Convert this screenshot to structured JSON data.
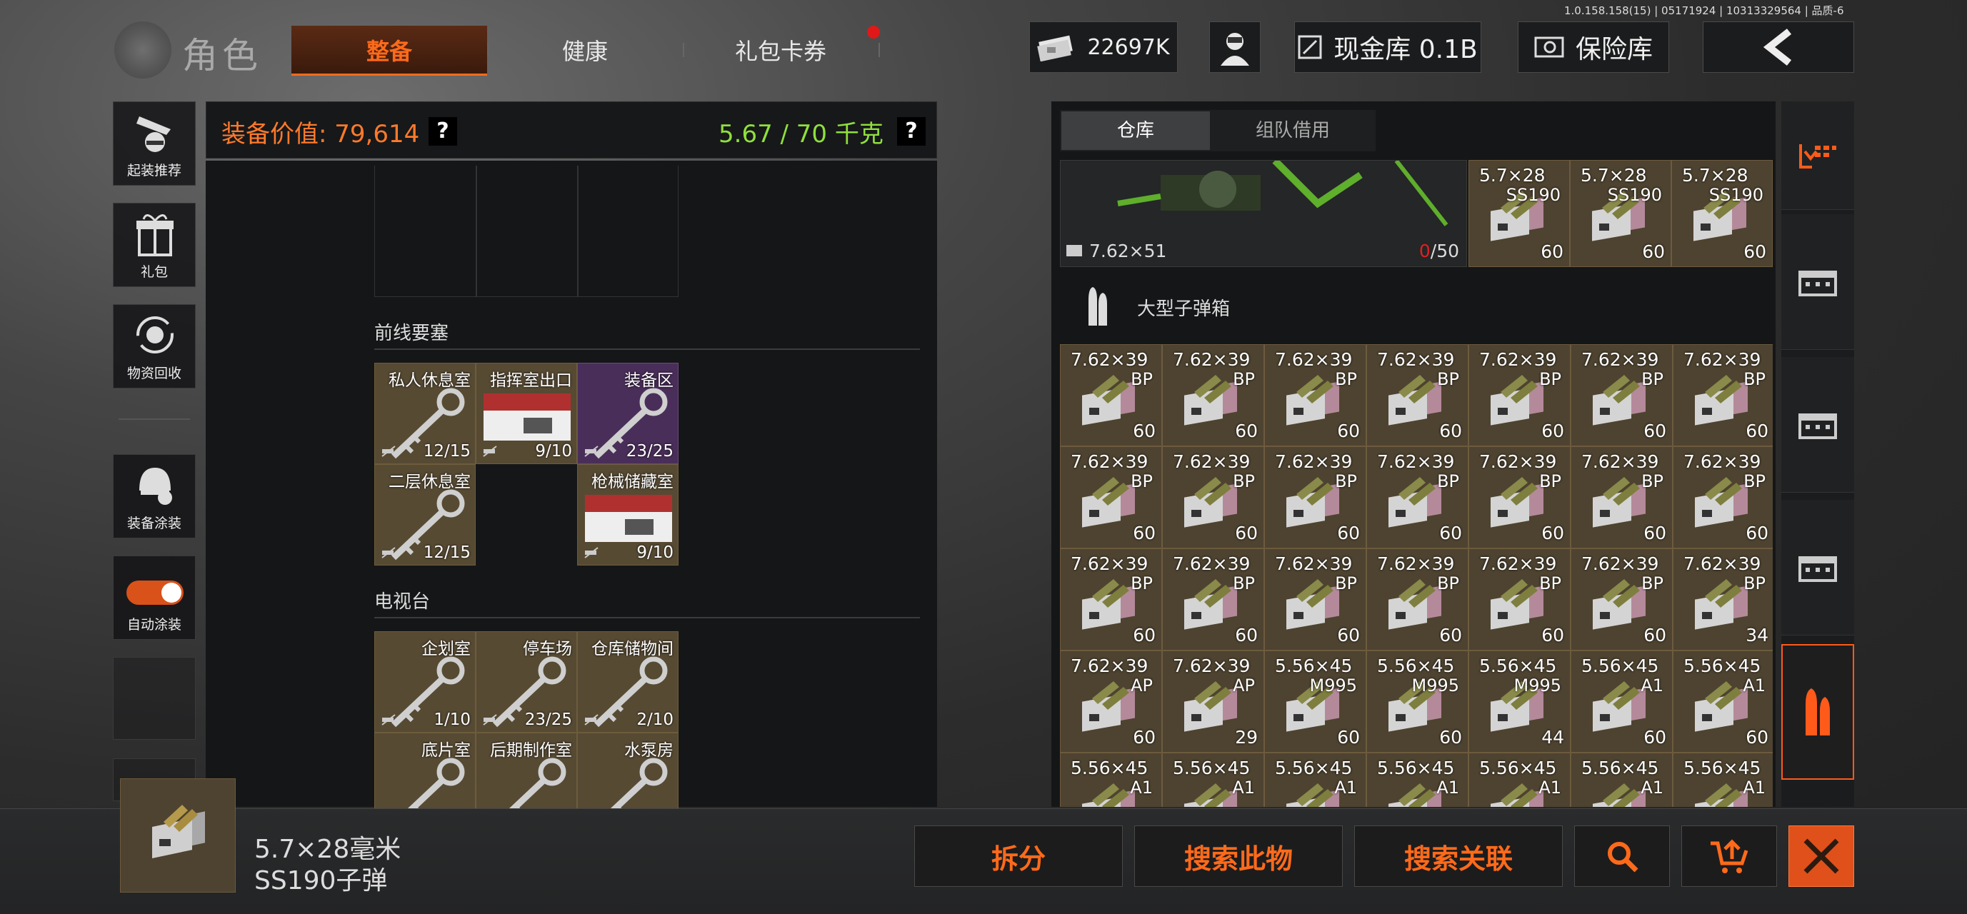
{
  "version": "1.0.158.158(15) | 05171924 | 10313329564 | 品质-6",
  "header": {
    "title": "角色",
    "tabs": [
      "整备",
      "健康",
      "礼包卡券"
    ],
    "currency": "22697K",
    "cash_vault": "现金库 0.1B",
    "safe": "保险库"
  },
  "sidebar": [
    "起装推荐",
    "礼包",
    "物资回收",
    "装备涂装",
    "自动涂装"
  ],
  "left_panel": {
    "value_label": "装备价值: 79,614",
    "help1": "?",
    "weight": "5.67 / 70 千克",
    "help2": "?",
    "section1": "前线要塞",
    "keys1": [
      {
        "name": "私人休息室",
        "count": "12/15"
      },
      {
        "name": "指挥室出口",
        "count": "9/10"
      },
      {
        "name": "装备区",
        "count": "23/25"
      },
      {
        "name": "二层休息室",
        "count": "12/15"
      },
      {
        "name": "枪械储藏室",
        "count": "9/10"
      }
    ],
    "section2": "电视台",
    "keys2": [
      {
        "name": "企划室",
        "count": "1/10"
      },
      {
        "name": "停车场",
        "count": "23/25"
      },
      {
        "name": "仓库储物间",
        "count": "2/10"
      },
      {
        "name": "底片室",
        "count": ""
      },
      {
        "name": "后期制作室",
        "count": ""
      },
      {
        "name": "水泵房",
        "count": ""
      }
    ]
  },
  "warehouse": {
    "tabs": [
      "仓库",
      "组队借用"
    ],
    "gun_caliber": "7.62×51",
    "gun_ammo_cur": "0",
    "gun_ammo_max": "/50",
    "top_ammo": [
      {
        "cal": "5.7×28",
        "var": "SS190",
        "qty": "60"
      },
      {
        "cal": "5.7×28",
        "var": "SS190",
        "qty": "60"
      },
      {
        "cal": "5.7×28",
        "var": "SS190",
        "qty": "60"
      }
    ],
    "section": "大型子弹箱",
    "grid": [
      {
        "cal": "7.62×39",
        "var": "BP",
        "qty": "60"
      },
      {
        "cal": "7.62×39",
        "var": "BP",
        "qty": "60"
      },
      {
        "cal": "7.62×39",
        "var": "BP",
        "qty": "60"
      },
      {
        "cal": "7.62×39",
        "var": "BP",
        "qty": "60"
      },
      {
        "cal": "7.62×39",
        "var": "BP",
        "qty": "60"
      },
      {
        "cal": "7.62×39",
        "var": "BP",
        "qty": "60"
      },
      {
        "cal": "7.62×39",
        "var": "BP",
        "qty": "60"
      },
      {
        "cal": "7.62×39",
        "var": "BP",
        "qty": "60"
      },
      {
        "cal": "7.62×39",
        "var": "BP",
        "qty": "60"
      },
      {
        "cal": "7.62×39",
        "var": "BP",
        "qty": "60"
      },
      {
        "cal": "7.62×39",
        "var": "BP",
        "qty": "60"
      },
      {
        "cal": "7.62×39",
        "var": "BP",
        "qty": "60"
      },
      {
        "cal": "7.62×39",
        "var": "BP",
        "qty": "60"
      },
      {
        "cal": "7.62×39",
        "var": "BP",
        "qty": "60"
      },
      {
        "cal": "7.62×39",
        "var": "BP",
        "qty": "60"
      },
      {
        "cal": "7.62×39",
        "var": "BP",
        "qty": "60"
      },
      {
        "cal": "7.62×39",
        "var": "BP",
        "qty": "60"
      },
      {
        "cal": "7.62×39",
        "var": "BP",
        "qty": "60"
      },
      {
        "cal": "7.62×39",
        "var": "BP",
        "qty": "60"
      },
      {
        "cal": "7.62×39",
        "var": "BP",
        "qty": "60"
      },
      {
        "cal": "7.62×39",
        "var": "BP",
        "qty": "34"
      },
      {
        "cal": "7.62×39",
        "var": "AP",
        "qty": "60"
      },
      {
        "cal": "7.62×39",
        "var": "AP",
        "qty": "29"
      },
      {
        "cal": "5.56×45",
        "var": "M995",
        "qty": "60"
      },
      {
        "cal": "5.56×45",
        "var": "M995",
        "qty": "60"
      },
      {
        "cal": "5.56×45",
        "var": "M995",
        "qty": "44"
      },
      {
        "cal": "5.56×45",
        "var": "A1",
        "qty": "60"
      },
      {
        "cal": "5.56×45",
        "var": "A1",
        "qty": "60"
      },
      {
        "cal": "5.56×45",
        "var": "A1",
        "qty": ""
      },
      {
        "cal": "5.56×45",
        "var": "A1",
        "qty": ""
      },
      {
        "cal": "5.56×45",
        "var": "A1",
        "qty": ""
      },
      {
        "cal": "5.56×45",
        "var": "A1",
        "qty": ""
      },
      {
        "cal": "5.56×45",
        "var": "A1",
        "qty": ""
      },
      {
        "cal": "5.56×45",
        "var": "A1",
        "qty": ""
      },
      {
        "cal": "5.56×45",
        "var": "A1",
        "qty": ""
      }
    ]
  },
  "selected_item": {
    "line1": "5.7×28毫米",
    "line2": "SS190子弹"
  },
  "actions": {
    "split": "拆分",
    "search_item": "搜索此物",
    "search_related": "搜索关联"
  },
  "colors": {
    "accent": "#ff6a1a",
    "weight_green": "#8fe03c",
    "value_orange": "#ff7a2a",
    "cell_gold": "#4e4330",
    "key_purple": "#4a2e5a"
  }
}
